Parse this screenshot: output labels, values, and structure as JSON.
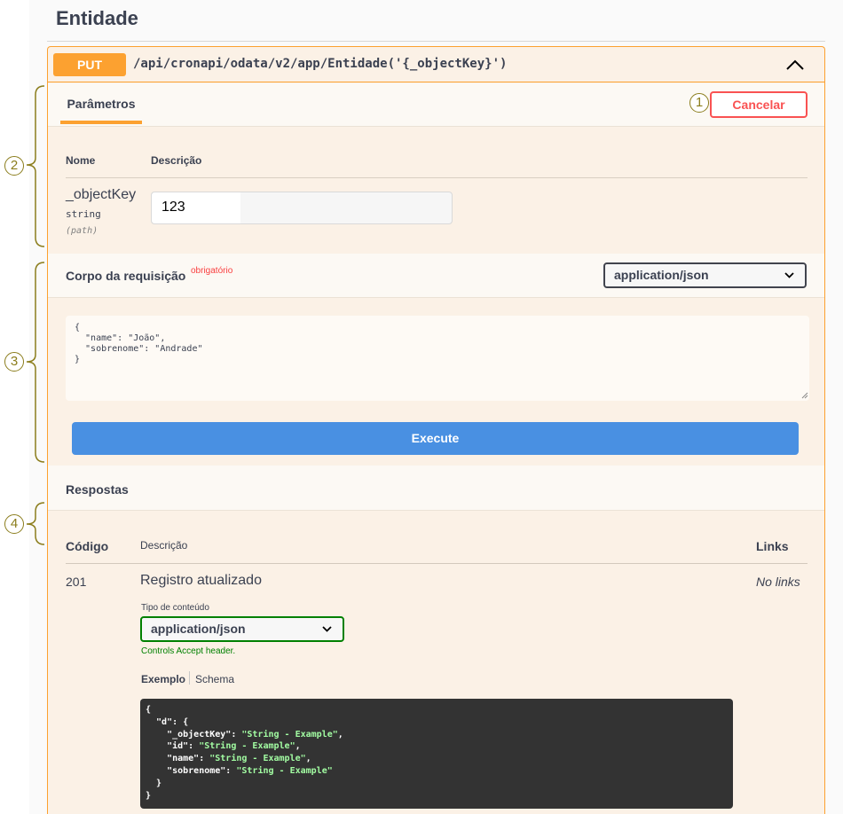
{
  "section": {
    "title": "Entidade"
  },
  "operation": {
    "method": "PUT",
    "path": "/api/cronapi/odata/v2/app/Entidade('{_objectKey}')"
  },
  "parameters": {
    "tab_label": "Parâmetros",
    "cancel_label": "Cancelar",
    "col_name": "Nome",
    "col_desc": "Descrição",
    "param": {
      "name": "_objectKey",
      "type": "string",
      "in": "(path)",
      "value": "123"
    }
  },
  "request_body": {
    "label": "Corpo da requisição",
    "required": "obrigatório",
    "content_type": "application/json",
    "value": "{\n  \"name\": \"João\",\n  \"sobrenome\": \"Andrade\"\n}"
  },
  "execute_label": "Execute",
  "responses": {
    "label": "Respostas",
    "col_code": "Código",
    "col_desc": "Descrição",
    "col_links": "Links",
    "rows": [
      {
        "code": "201",
        "description": "Registro atualizado",
        "links": "No links",
        "content_type_label": "Tipo de conteúdo",
        "content_type": "application/json",
        "controls_prefix": "Controls ",
        "controls_code": "Accept",
        "controls_suffix": " header.",
        "tab_example": "Exemplo",
        "tab_schema": "Schema"
      }
    ]
  },
  "annotations": [
    "1",
    "2",
    "3",
    "4"
  ],
  "colors": {
    "put": "#fca130",
    "cancel": "#f95252",
    "execute": "#4990e2",
    "annotation": "#8b7d1c"
  }
}
